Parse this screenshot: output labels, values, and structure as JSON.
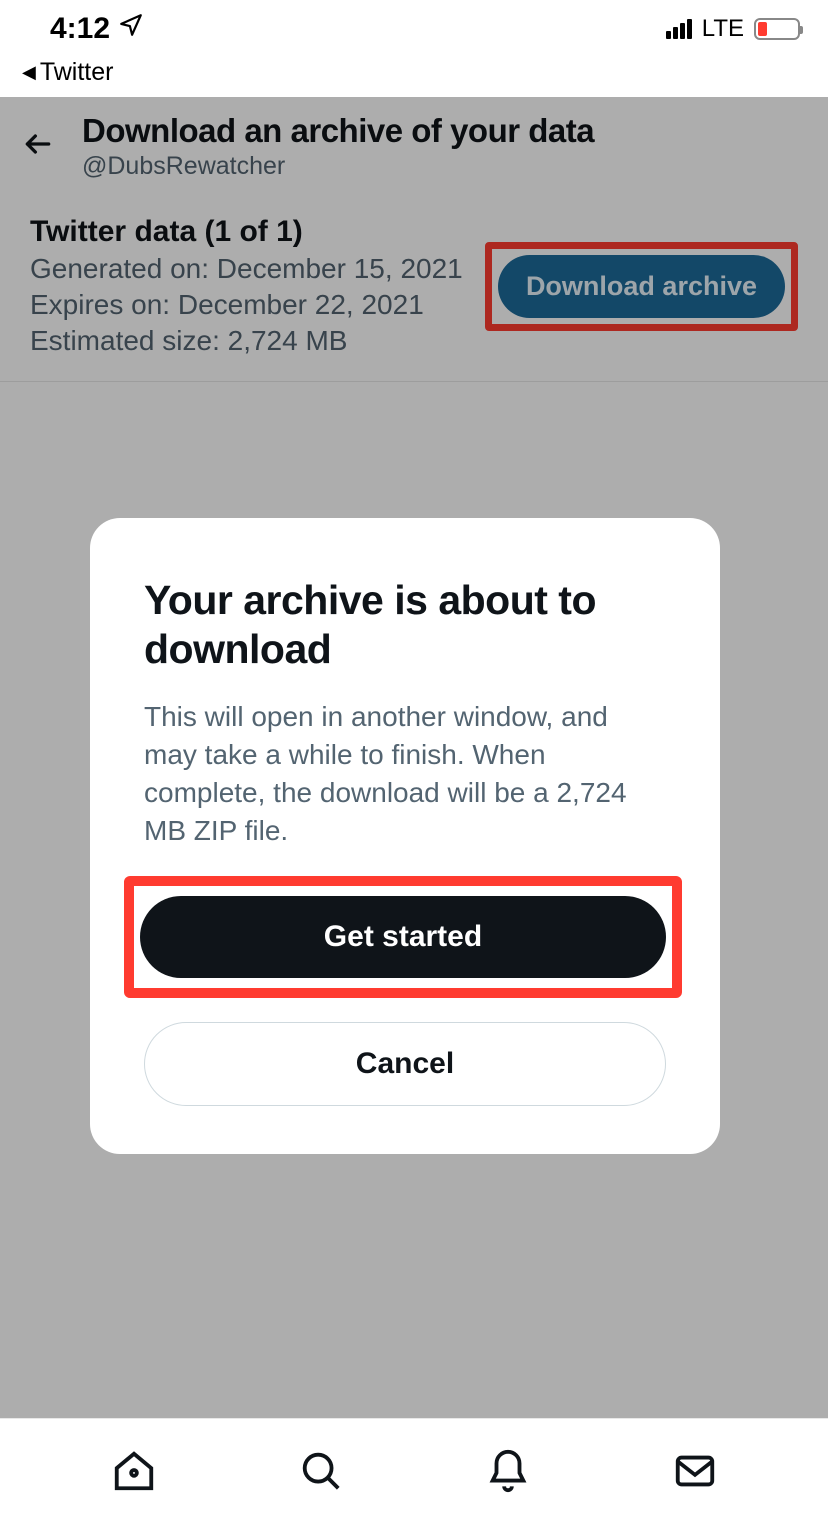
{
  "status": {
    "time": "4:12",
    "network": "LTE"
  },
  "breadcrumb": {
    "app": "Twitter"
  },
  "header": {
    "title": "Download an archive of your data",
    "handle": "@DubsRewatcher"
  },
  "archive": {
    "title": "Twitter data (1 of 1)",
    "generated": "Generated on: December 15, 2021",
    "expires": "Expires on: December 22, 2021",
    "size": "Estimated size: 2,724 MB",
    "download_label": "Download archive"
  },
  "modal": {
    "title": "Your archive is about to download",
    "body": "This will open in another window, and may take a while to finish. When complete, the download will be a 2,724 MB ZIP file.",
    "primary": "Get started",
    "secondary": "Cancel"
  }
}
